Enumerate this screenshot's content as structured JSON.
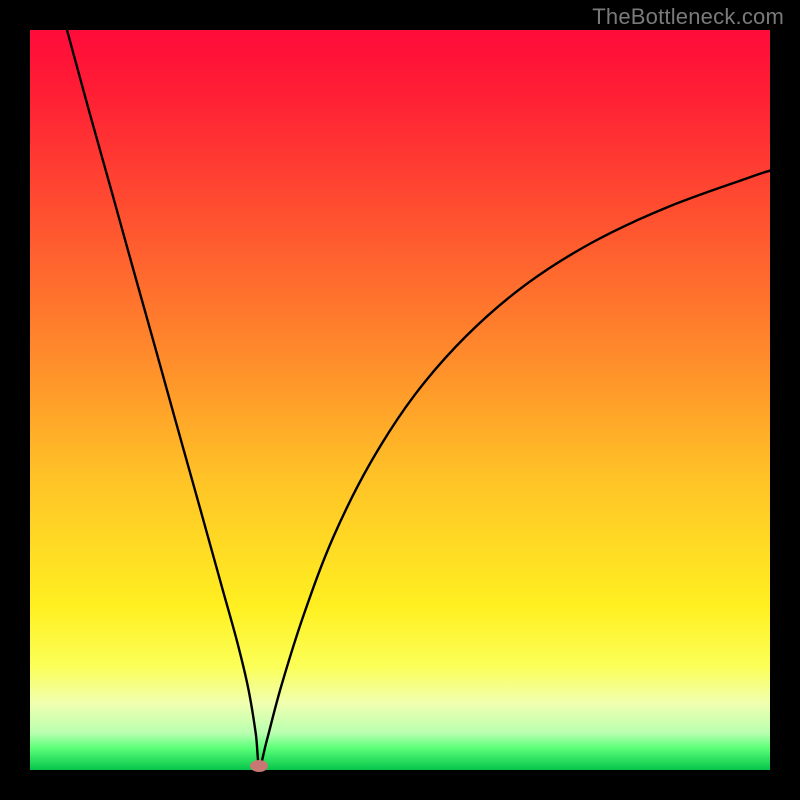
{
  "watermark": "TheBottleneck.com",
  "chart_data": {
    "type": "line",
    "title": "",
    "xlabel": "",
    "ylabel": "",
    "xlim": [
      0,
      100
    ],
    "ylim": [
      0,
      100
    ],
    "grid": false,
    "legend": false,
    "background_gradient": {
      "stops": [
        {
          "pos": 0.0,
          "color": "#ff0b3a"
        },
        {
          "pos": 0.25,
          "color": "#ff5030"
        },
        {
          "pos": 0.6,
          "color": "#ffc127"
        },
        {
          "pos": 0.78,
          "color": "#fff021"
        },
        {
          "pos": 0.95,
          "color": "#b9ffb0"
        },
        {
          "pos": 1.0,
          "color": "#05c54a"
        }
      ]
    },
    "series": [
      {
        "name": "bottleneck-curve",
        "color": "#000000",
        "x": [
          5.0,
          8.0,
          11.0,
          14.0,
          17.0,
          20.0,
          23.0,
          26.0,
          28.0,
          29.5,
          30.5,
          31.0,
          32.0,
          34.0,
          37.0,
          41.0,
          46.0,
          52.0,
          59.0,
          67.0,
          76.0,
          86.0,
          97.0,
          100.0
        ],
        "values": [
          100.0,
          89.0,
          78.3,
          67.5,
          56.8,
          46.0,
          35.3,
          24.5,
          17.3,
          11.0,
          5.0,
          0.5,
          4.0,
          11.5,
          21.0,
          31.5,
          41.5,
          50.7,
          58.7,
          65.6,
          71.3,
          76.0,
          80.0,
          81.0
        ]
      }
    ],
    "marker": {
      "name": "optimal-point",
      "x": 31.0,
      "y": 0.5,
      "color": "#c77872"
    }
  }
}
